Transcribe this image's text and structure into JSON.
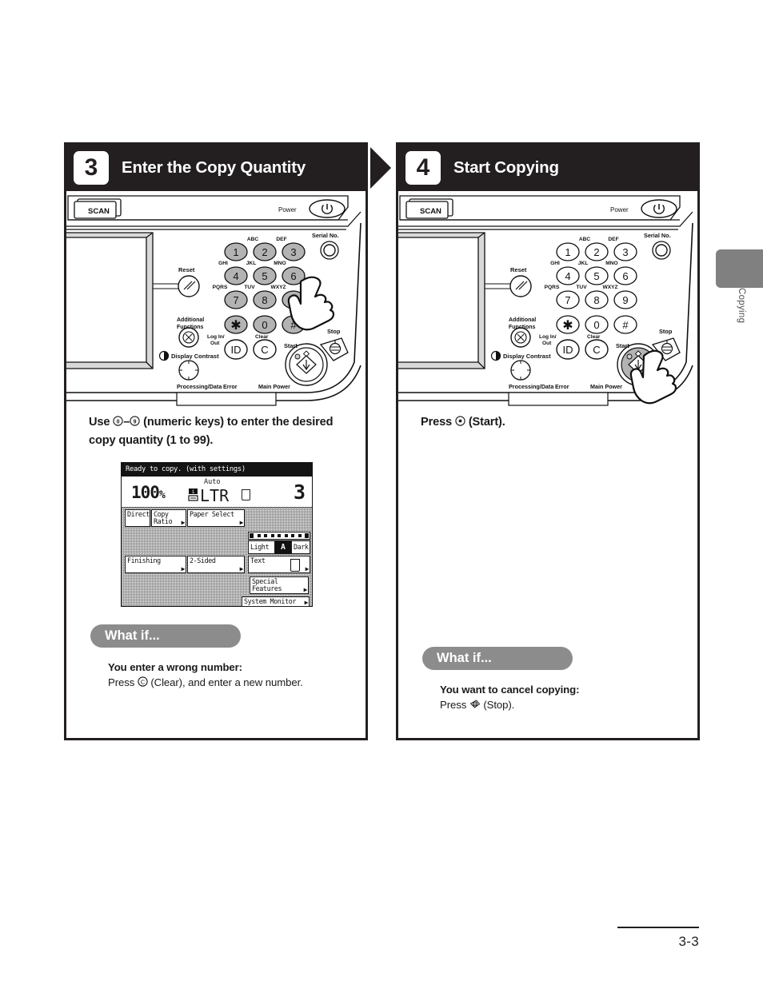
{
  "page": {
    "number": "3-3",
    "side_tab_label": "Copying"
  },
  "panels": [
    {
      "step": "3",
      "title": "Enter the Copy Quantity",
      "instruction_line1": "Use ⓪–⑨ (numeric keys) to enter the",
      "instruction_line2": "desired copy quantity (1 to 99).",
      "instruction_prefix": "Use",
      "instruction_mid": "(numeric keys) to enter the desired copy quantity (1 to 99).",
      "whatif": {
        "pill": "What if...",
        "question": "You enter a wrong number:",
        "answer": "Press © (Clear), and enter a new number.",
        "answer_prefix": "Press",
        "answer_suffix": "(Clear), and enter a new number."
      }
    },
    {
      "step": "4",
      "title": "Start Copying",
      "instruction_prefix": "Press",
      "instruction_mid": "(Start).",
      "whatif": {
        "pill": "What if...",
        "question": "You want to cancel copying:",
        "answer_prefix": "Press",
        "answer_suffix": "(Stop)."
      }
    }
  ],
  "control_panel": {
    "scan_button": "SCAN",
    "power_label": "Power",
    "serial_no_label": "Serial No.",
    "reset_label": "Reset",
    "additional_functions_label": "Additional\nFunctions",
    "display_contrast_label": "Display Contrast",
    "log_in_out_label": "Log In/\nOut",
    "clear_label": "Clear",
    "start_label": "Start",
    "stop_label": "Stop",
    "processing_data_label": "Processing/Data",
    "error_label": "Error",
    "main_power_label": "Main Power",
    "keypad": [
      {
        "digit": "1",
        "letters": ""
      },
      {
        "digit": "2",
        "letters": "ABC"
      },
      {
        "digit": "3",
        "letters": "DEF"
      },
      {
        "digit": "4",
        "letters": "GHI"
      },
      {
        "digit": "5",
        "letters": "JKL"
      },
      {
        "digit": "6",
        "letters": "MNO"
      },
      {
        "digit": "7",
        "letters": "PQRS"
      },
      {
        "digit": "8",
        "letters": "TUV"
      },
      {
        "digit": "9",
        "letters": "WXYZ"
      },
      {
        "digit": "∗",
        "letters": ""
      },
      {
        "digit": "0",
        "letters": ""
      },
      {
        "digit": "#",
        "letters": ""
      }
    ],
    "id_key": "ID",
    "clear_key": "C"
  },
  "lcd": {
    "status_bar": "Ready to copy. (with settings)",
    "zoom_ratio": "100",
    "zoom_unit": "%",
    "paper_auto": "Auto",
    "paper_size": "LTR",
    "quantity": "3",
    "buttons": {
      "direct": "Direct",
      "copy_ratio": "Copy\nRatio",
      "paper_select": "Paper Select",
      "finishing": "Finishing",
      "two_sided": "2-Sided",
      "light": "Light",
      "auto_density": "A",
      "dark": "Dark",
      "text": "Text",
      "special_features": "Special\nFeatures",
      "system_monitor": "System Monitor"
    }
  },
  "colors": {
    "header_bg": "#231f20",
    "pill_gray": "#8c8c8c",
    "tab_gray": "#808080",
    "key_gray": "#b3b3b3"
  }
}
